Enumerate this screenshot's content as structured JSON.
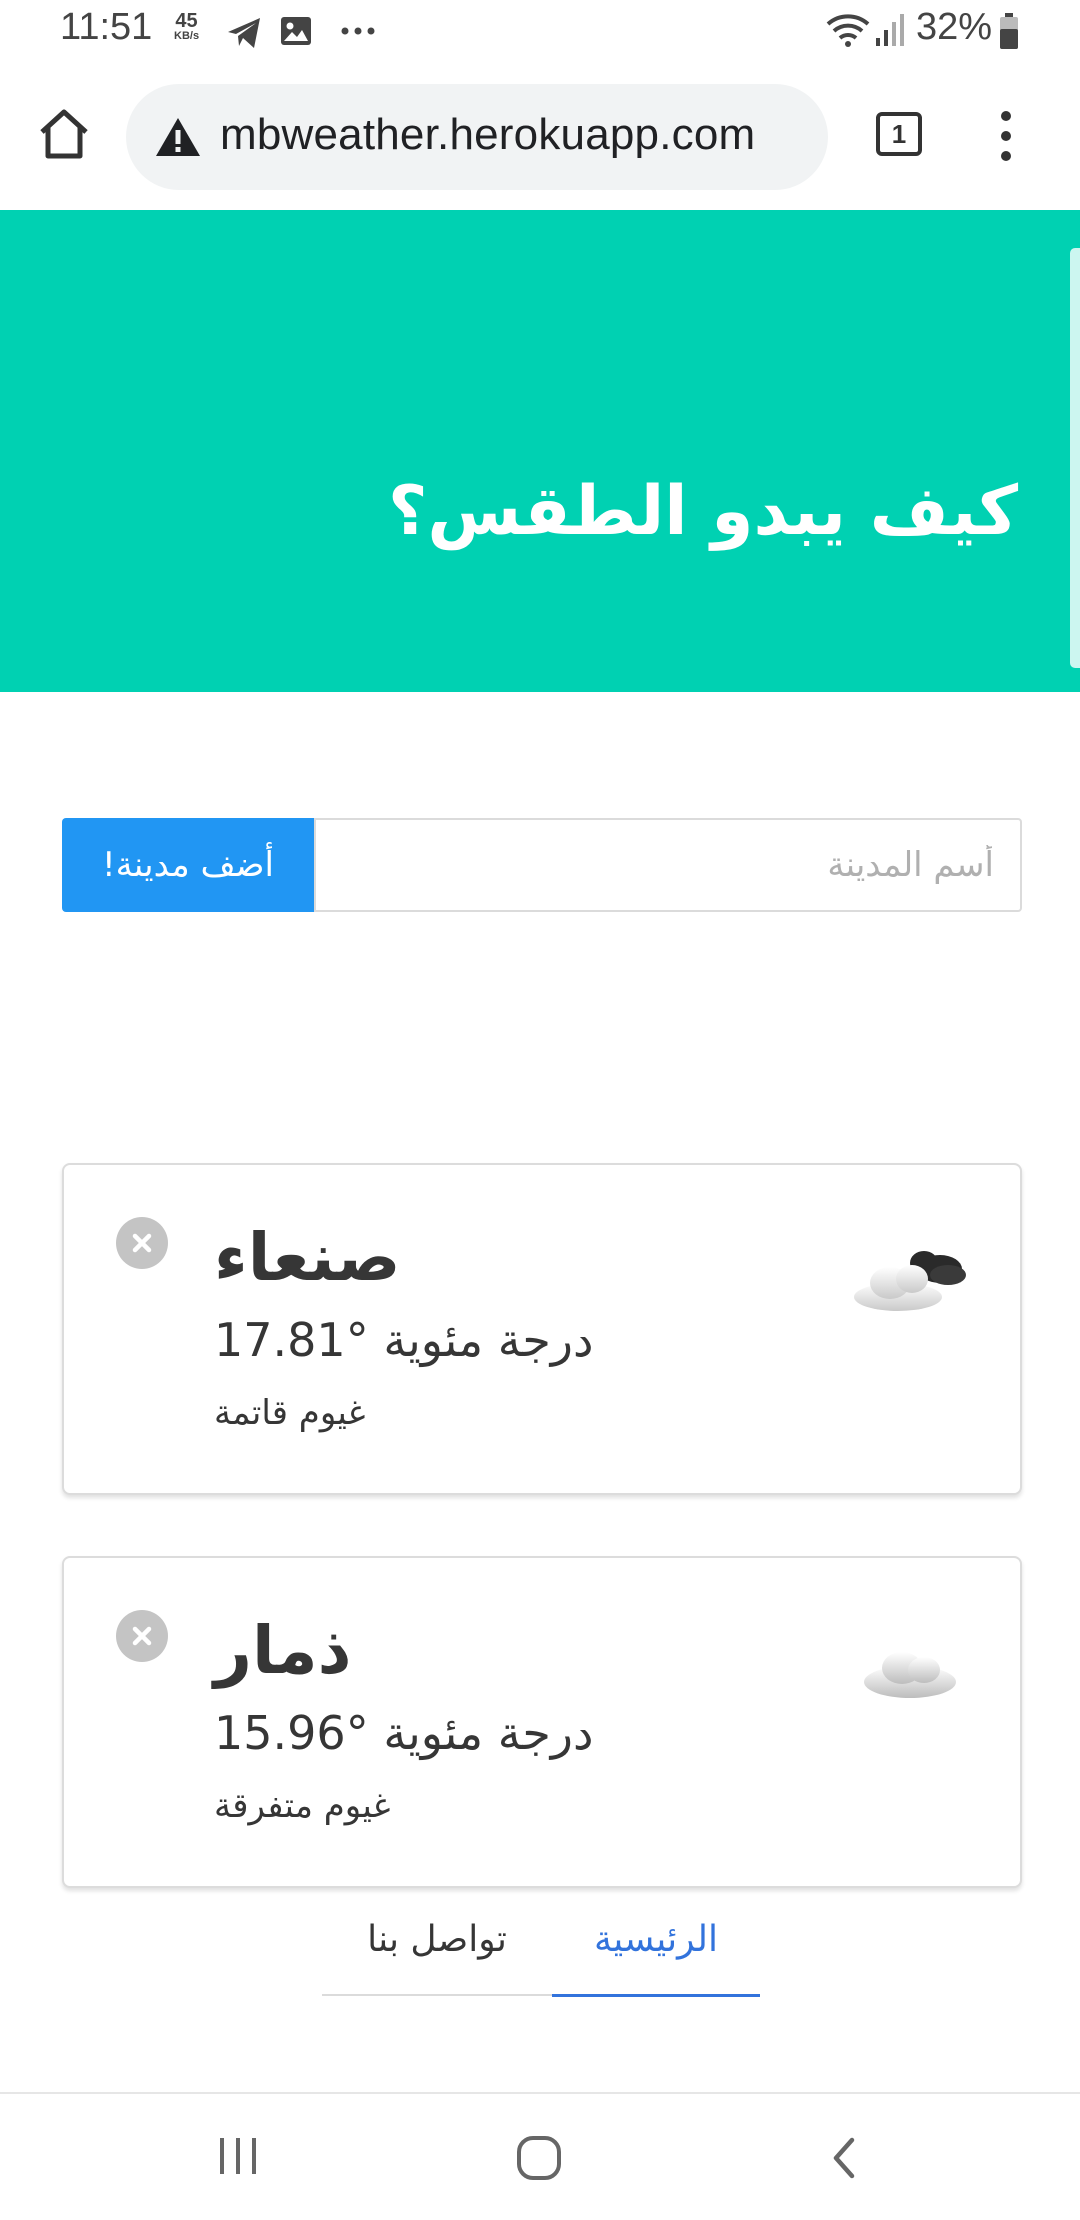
{
  "status_bar": {
    "time": "11:51",
    "speed_value": "45",
    "speed_unit": "KB/s",
    "battery": "32%",
    "icons": [
      "telegram-icon",
      "gallery-icon",
      "more-notifications-icon",
      "wifi-icon",
      "signal-icon",
      "battery-icon"
    ]
  },
  "browser": {
    "url": "mbweather.herokuapp.com",
    "tab_count": "1",
    "icons": [
      "home-icon",
      "warning-icon",
      "tabs-icon",
      "menu-icon"
    ]
  },
  "hero": {
    "title": "كيف يبدو الطقس؟",
    "background_color": "#00d1b2"
  },
  "form": {
    "placeholder": "أسم المدينة",
    "add_button_label": "أضف مدينة!",
    "button_color": "#2196f3"
  },
  "cities": [
    {
      "name": "صنعاء",
      "temperature": "17.81°",
      "unit": "درجة مئوية",
      "description": "غيوم قاتمة",
      "icon": "broken-clouds-icon"
    },
    {
      "name": "ذمار",
      "temperature": "15.96°",
      "unit": "درجة مئوية",
      "description": "غيوم متفرقة",
      "icon": "scattered-clouds-icon"
    }
  ],
  "tabs": {
    "home": "الرئيسية",
    "contact": "تواصل بنا",
    "active": "home",
    "active_color": "#3273dc"
  },
  "nav_bar": {
    "icons": [
      "recent-apps-icon",
      "home-circle-icon",
      "back-icon"
    ]
  }
}
